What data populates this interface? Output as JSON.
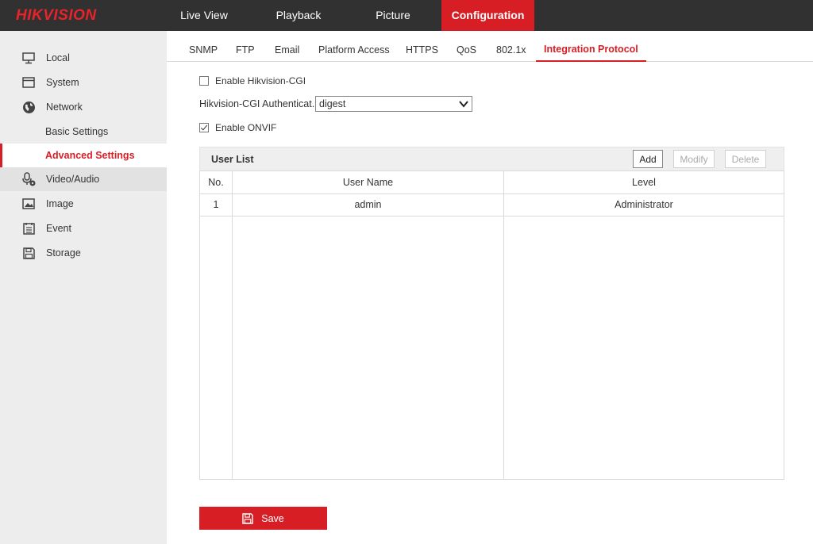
{
  "brand": {
    "logo": "HIKVISION",
    "accent": "#d81e25",
    "topbar_bg": "#313131"
  },
  "nav": {
    "live_view": "Live View",
    "playback": "Playback",
    "picture": "Picture",
    "configuration": "Configuration"
  },
  "sidebar": {
    "local": {
      "label": "Local",
      "icon": "monitor-icon"
    },
    "system": {
      "label": "System",
      "icon": "window-icon"
    },
    "network": {
      "label": "Network",
      "icon": "globe-icon"
    },
    "basic_settings": {
      "label": "Basic Settings"
    },
    "advanced_settings": {
      "label": "Advanced Settings"
    },
    "video_audio": {
      "label": "Video/Audio",
      "icon": "microphone-camera-icon"
    },
    "image": {
      "label": "Image",
      "icon": "image-icon"
    },
    "event": {
      "label": "Event",
      "icon": "list-icon"
    },
    "storage": {
      "label": "Storage",
      "icon": "floppy-icon"
    }
  },
  "tabs": {
    "snmp": "SNMP",
    "ftp": "FTP",
    "email": "Email",
    "platform_access": "Platform Access",
    "https": "HTTPS",
    "qos": "QoS",
    "dot1x": "802.1x",
    "integration_protocol": "Integration Protocol"
  },
  "form": {
    "enable_cgi": {
      "label": "Enable Hikvision-CGI",
      "checked": false
    },
    "cgi_auth": {
      "label": "Hikvision-CGI Authenticat...",
      "value": "digest"
    },
    "enable_onvif": {
      "label": "Enable ONVIF",
      "checked": true
    }
  },
  "user_list": {
    "title": "User List",
    "add": "Add",
    "modify": "Modify",
    "delete": "Delete",
    "columns": {
      "no": "No.",
      "user_name": "User Name",
      "level": "Level"
    },
    "rows": [
      {
        "no": "1",
        "user_name": "admin",
        "level": "Administrator"
      }
    ]
  },
  "save": {
    "label": "Save",
    "icon": "floppy-icon"
  }
}
